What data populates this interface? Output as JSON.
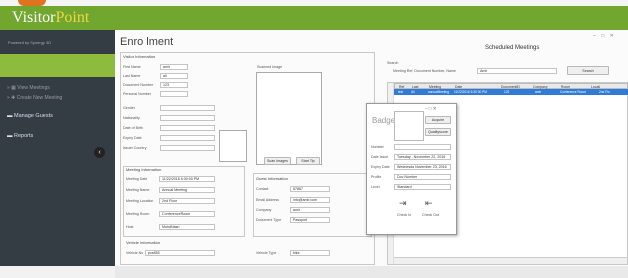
{
  "app": {
    "brand_part1": "Visitor",
    "brand_part2": "Point",
    "powered_by": "Powered by Synergy 3D"
  },
  "sidebar": {
    "items": [
      {
        "label": "View Meetings"
      },
      {
        "label": "Create New Meeting"
      },
      {
        "label": "Manage Guests"
      },
      {
        "label": "Reports"
      }
    ],
    "collapse_glyph": "‹"
  },
  "page": {
    "title": "Enro lment",
    "window_controls": "– □ ✕"
  },
  "visitor": {
    "section_label": "Visitor Information",
    "first_name_label": "First Name",
    "first_name": "amir",
    "last_name_label": "Last Name",
    "last_name": "ali",
    "doc_number_label": "Document Number",
    "doc_number": "123",
    "personal_number_label": "Personal Number",
    "personal_number": "",
    "gender_label": "Gender",
    "gender": "",
    "nationality_label": "Nationality",
    "nationality": "",
    "dob_label": "Date of Birth",
    "dob": "",
    "expiry_label": "Expiry Date",
    "expiry": "",
    "issuer_label": "Issuer Country",
    "issuer": "",
    "scanned_label": "Scanned Image",
    "scan_images_button": "Scan Images",
    "start_tip_button": "Start Tip"
  },
  "meeting_info": {
    "section_label": "Meeting Information",
    "date_label": "Meeting Date",
    "date": "11/22/2016 6:30:00 PM",
    "name_label": "Meeting Name",
    "name": "Annual Meeting",
    "location_label": "Meeting Location",
    "location": "2nd Floor",
    "room_label": "Meeting Room",
    "room": "ConferenceRoom",
    "host_label": "Host",
    "host": "MohdNasri"
  },
  "guest_info": {
    "section_label": "Guest Information",
    "contact_label": "Contact",
    "contact": "87867",
    "email_label": "Email Address",
    "email": "info@amir.com",
    "company_label": "Company",
    "company": "amir",
    "doctype_label": "Document Type",
    "doctype": "Passport"
  },
  "vehicle": {
    "section_label": "Vehicle Information",
    "vehicle_no_label": "Vehicle No",
    "vehicle_no": "pcs855",
    "vehicle_type_label": "Vehicle Type",
    "vehicle_type": "bike"
  },
  "meetings": {
    "title": "Scheduled Meetings",
    "search_label": "Search",
    "filter_label": "Meeting Ref, Document Number, Name",
    "search_value": "Amir",
    "search_button": "Search",
    "columns": [
      "Ref",
      "Last",
      "Meeting",
      "Date",
      "DocumentID",
      "Company",
      "Room",
      "Locati"
    ],
    "rows": [
      [
        "test",
        "Ali",
        "annualMeeting",
        "11/22/2016 6:30:00 PM",
        "123",
        "amir",
        "Conference Room",
        "2nd Flo"
      ]
    ]
  },
  "badge": {
    "title": "Badger",
    "controls": "– □ ✕",
    "acquire_button": "Acquire",
    "qualityscore_button": "Qualityscore",
    "number_label": "Number",
    "date_issue_label": "Date Issue",
    "date_issue": "Tuesday , November 22, 2016",
    "expiry_label": "Expiry Date",
    "expiry": "Wednesda November 23, 2016",
    "profile_label": "Profile",
    "profile": "Doc Number",
    "level_label": "Level",
    "level": "Standard",
    "check_in_label": "Check In",
    "check_out_label": "Check Out"
  }
}
